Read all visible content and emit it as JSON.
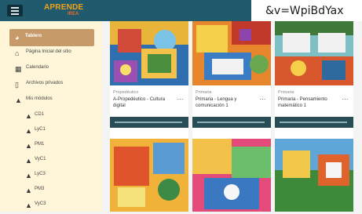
{
  "header": {
    "logo_line1": "APRENDE",
    "logo_line2": "IREA",
    "overlay_text": "&v=WpiBdYax"
  },
  "sidebar": {
    "items": [
      {
        "label": "Tablero",
        "icon": "dashboard-icon",
        "active": true
      },
      {
        "label": "Página Inicial del sitio",
        "icon": "home-icon"
      },
      {
        "label": "Calendario",
        "icon": "calendar-icon"
      },
      {
        "label": "Archivos privados",
        "icon": "file-icon"
      },
      {
        "label": "Mis módulos",
        "icon": "graduation-cap-icon"
      }
    ],
    "modules": [
      {
        "label": "CD1",
        "icon": "graduation-cap-icon"
      },
      {
        "label": "LyC1",
        "icon": "graduation-cap-icon"
      },
      {
        "label": "PM1",
        "icon": "graduation-cap-icon"
      },
      {
        "label": "VyC1",
        "icon": "graduation-cap-icon"
      },
      {
        "label": "LyC3",
        "icon": "graduation-cap-icon"
      },
      {
        "label": "PM3",
        "icon": "graduation-cap-icon"
      },
      {
        "label": "VyC3",
        "icon": "graduation-cap-icon"
      }
    ]
  },
  "courses": [
    {
      "category": "Propedéutico",
      "name": "A-Propedéutico - Cultura digital",
      "menu": "⋯"
    },
    {
      "category": "Primaria",
      "name": "Primaria - Lengua y comunicación 1",
      "menu": "⋯"
    },
    {
      "category": "Primaria",
      "name": "Primaria - Pensamiento matemático 1",
      "menu": "⋯"
    },
    {
      "category": "",
      "name": "",
      "menu": ""
    },
    {
      "category": "",
      "name": "",
      "menu": ""
    },
    {
      "category": "",
      "name": "",
      "menu": ""
    }
  ],
  "colors": {
    "topbar": "#205a6c",
    "sidebar_bg": "#fff6d9",
    "active_item": "#c79a6a",
    "card_bar": "#294d57",
    "logo": "#f0a31a"
  }
}
